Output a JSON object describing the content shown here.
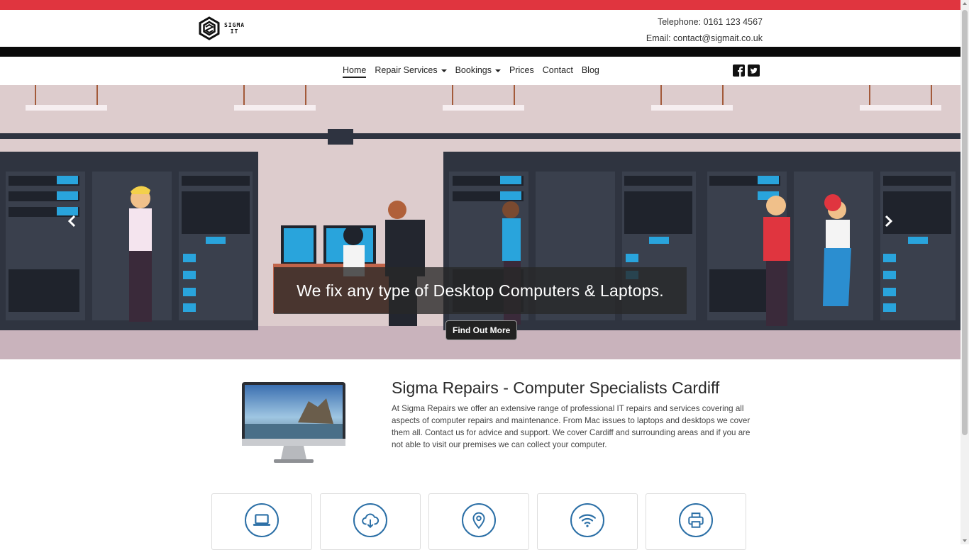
{
  "brand": {
    "logo_line1": "SIGMA",
    "logo_line2": "IT",
    "accent_color": "#e0353f"
  },
  "contact": {
    "telephone": "Telephone: 0161 123 4567",
    "email": "Email: contact@sigmait.co.uk"
  },
  "nav": {
    "items": [
      {
        "label": "Home",
        "active": true
      },
      {
        "label": "Repair Services",
        "dropdown": true
      },
      {
        "label": "Bookings",
        "dropdown": true
      },
      {
        "label": "Prices"
      },
      {
        "label": "Contact"
      },
      {
        "label": "Blog"
      }
    ],
    "social_icons": [
      "facebook-icon",
      "twitter-icon"
    ]
  },
  "hero": {
    "caption": "We fix any type of Desktop Computers & Laptops.",
    "button_label": "Find Out More",
    "prev_icon": "chevron-left-icon",
    "next_icon": "chevron-right-icon"
  },
  "intro": {
    "title": "Sigma Repairs - Computer Specialists Cardiff",
    "text": "At Sigma Repairs we offer an extensive range of professional IT repairs and services covering all aspects of computer repairs and maintenance. From Mac issues to laptops and desktops we cover them all. Contact us for advice and support. We cover Cardiff and surrounding areas and if you are not able to visit our premises we can collect your computer."
  },
  "service_cards": [
    {
      "icon": "laptop-icon"
    },
    {
      "icon": "cloud-download-icon"
    },
    {
      "icon": "map-pin-icon"
    },
    {
      "icon": "wifi-icon"
    },
    {
      "icon": "printer-icon"
    }
  ]
}
